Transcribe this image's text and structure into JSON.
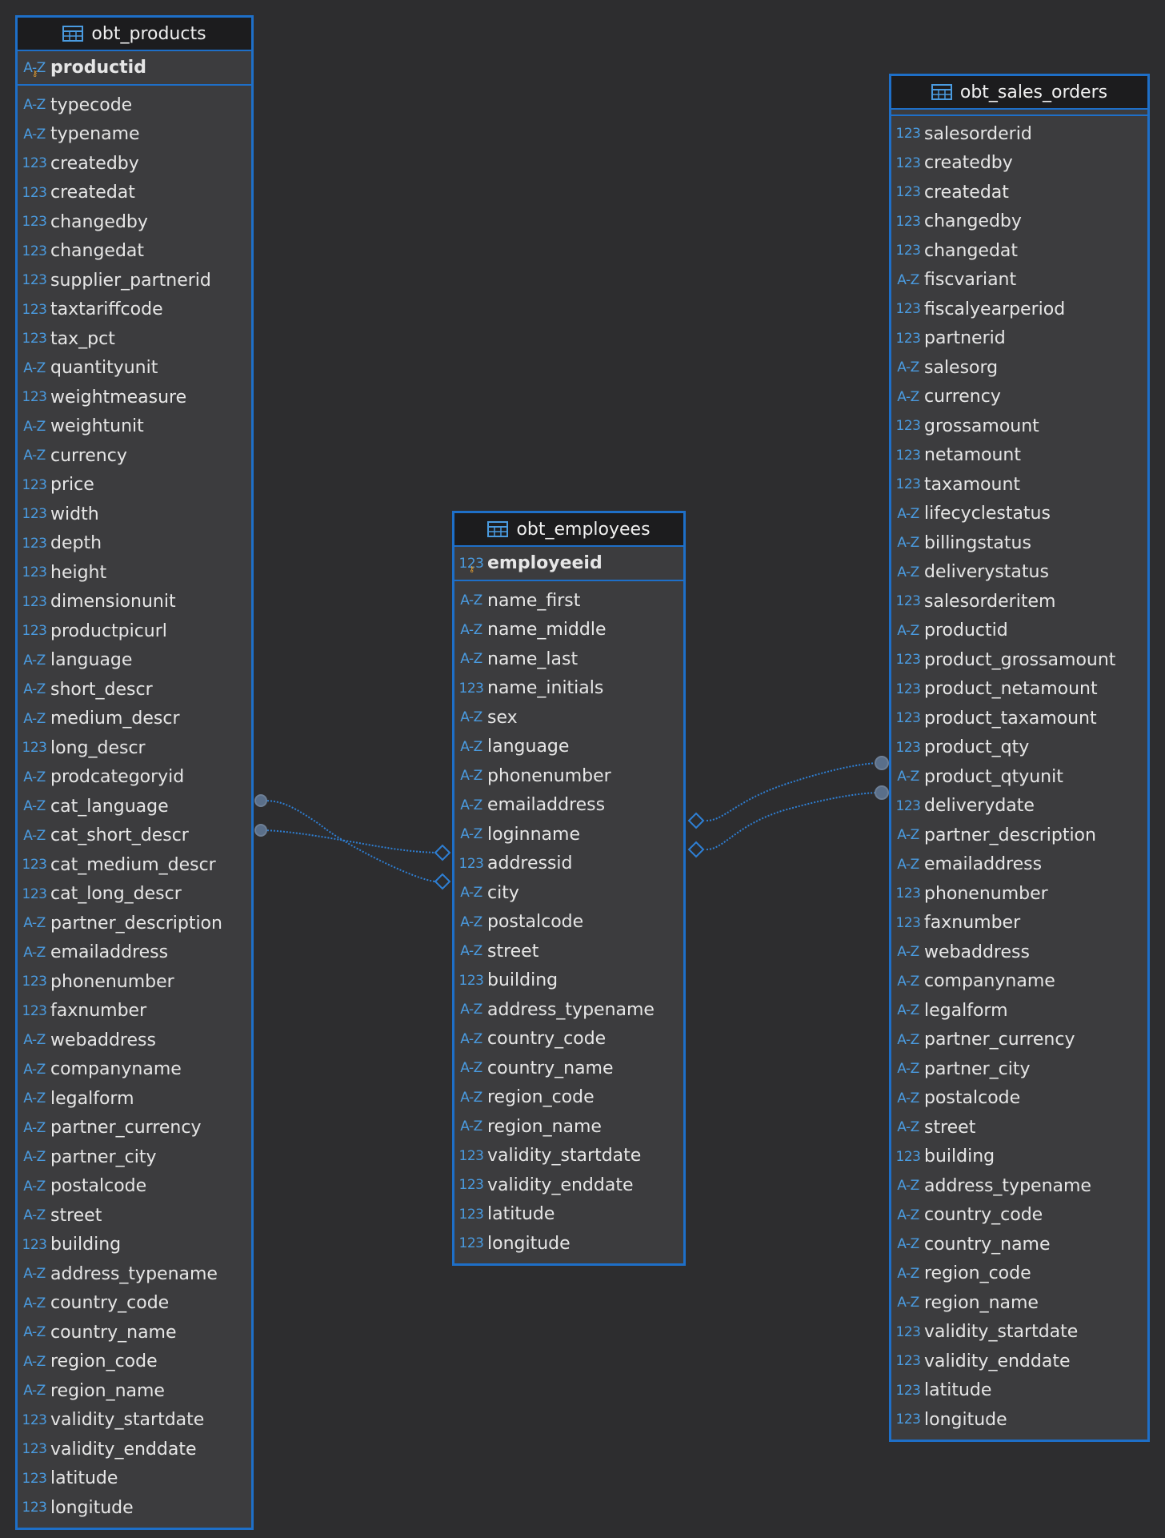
{
  "colors": {
    "background": "#2d2d2f",
    "table": "#3c3c3e",
    "border": "#1e6fc8",
    "type_icon": "#4a9be0",
    "key_icon": "#e8a030",
    "link": "#2e7fd4"
  },
  "icons": {
    "table": "table-icon",
    "text_type": "A-Z",
    "numeric_type": "123"
  },
  "tables": {
    "products": {
      "title": "obt_products",
      "pk": {
        "type": "A-Z",
        "name": "productid"
      },
      "columns": [
        {
          "type": "A-Z",
          "name": "typecode"
        },
        {
          "type": "A-Z",
          "name": "typename"
        },
        {
          "type": "123",
          "name": "createdby"
        },
        {
          "type": "123",
          "name": "createdat"
        },
        {
          "type": "123",
          "name": "changedby"
        },
        {
          "type": "123",
          "name": "changedat"
        },
        {
          "type": "123",
          "name": "supplier_partnerid"
        },
        {
          "type": "123",
          "name": "taxtariffcode"
        },
        {
          "type": "123",
          "name": "tax_pct"
        },
        {
          "type": "A-Z",
          "name": "quantityunit"
        },
        {
          "type": "123",
          "name": "weightmeasure"
        },
        {
          "type": "A-Z",
          "name": "weightunit"
        },
        {
          "type": "A-Z",
          "name": "currency"
        },
        {
          "type": "123",
          "name": "price"
        },
        {
          "type": "123",
          "name": "width"
        },
        {
          "type": "123",
          "name": "depth"
        },
        {
          "type": "123",
          "name": "height"
        },
        {
          "type": "123",
          "name": "dimensionunit"
        },
        {
          "type": "123",
          "name": "productpicurl"
        },
        {
          "type": "A-Z",
          "name": "language"
        },
        {
          "type": "A-Z",
          "name": "short_descr"
        },
        {
          "type": "A-Z",
          "name": "medium_descr"
        },
        {
          "type": "123",
          "name": "long_descr"
        },
        {
          "type": "A-Z",
          "name": "prodcategoryid"
        },
        {
          "type": "A-Z",
          "name": "cat_language"
        },
        {
          "type": "A-Z",
          "name": "cat_short_descr"
        },
        {
          "type": "123",
          "name": "cat_medium_descr"
        },
        {
          "type": "123",
          "name": "cat_long_descr"
        },
        {
          "type": "A-Z",
          "name": "partner_description"
        },
        {
          "type": "A-Z",
          "name": "emailaddress"
        },
        {
          "type": "123",
          "name": "phonenumber"
        },
        {
          "type": "123",
          "name": "faxnumber"
        },
        {
          "type": "A-Z",
          "name": "webaddress"
        },
        {
          "type": "A-Z",
          "name": "companyname"
        },
        {
          "type": "A-Z",
          "name": "legalform"
        },
        {
          "type": "A-Z",
          "name": "partner_currency"
        },
        {
          "type": "A-Z",
          "name": "partner_city"
        },
        {
          "type": "A-Z",
          "name": "postalcode"
        },
        {
          "type": "A-Z",
          "name": "street"
        },
        {
          "type": "123",
          "name": "building"
        },
        {
          "type": "A-Z",
          "name": "address_typename"
        },
        {
          "type": "A-Z",
          "name": "country_code"
        },
        {
          "type": "A-Z",
          "name": "country_name"
        },
        {
          "type": "A-Z",
          "name": "region_code"
        },
        {
          "type": "A-Z",
          "name": "region_name"
        },
        {
          "type": "123",
          "name": "validity_startdate"
        },
        {
          "type": "123",
          "name": "validity_enddate"
        },
        {
          "type": "123",
          "name": "latitude"
        },
        {
          "type": "123",
          "name": "longitude"
        }
      ]
    },
    "employees": {
      "title": "obt_employees",
      "pk": {
        "type": "123",
        "name": "employeeid"
      },
      "columns": [
        {
          "type": "A-Z",
          "name": "name_first"
        },
        {
          "type": "A-Z",
          "name": "name_middle"
        },
        {
          "type": "A-Z",
          "name": "name_last"
        },
        {
          "type": "123",
          "name": "name_initials"
        },
        {
          "type": "A-Z",
          "name": "sex"
        },
        {
          "type": "A-Z",
          "name": "language"
        },
        {
          "type": "A-Z",
          "name": "phonenumber"
        },
        {
          "type": "A-Z",
          "name": "emailaddress"
        },
        {
          "type": "A-Z",
          "name": "loginname"
        },
        {
          "type": "123",
          "name": "addressid"
        },
        {
          "type": "A-Z",
          "name": "city"
        },
        {
          "type": "A-Z",
          "name": "postalcode"
        },
        {
          "type": "A-Z",
          "name": "street"
        },
        {
          "type": "123",
          "name": "building"
        },
        {
          "type": "A-Z",
          "name": "address_typename"
        },
        {
          "type": "A-Z",
          "name": "country_code"
        },
        {
          "type": "A-Z",
          "name": "country_name"
        },
        {
          "type": "A-Z",
          "name": "region_code"
        },
        {
          "type": "A-Z",
          "name": "region_name"
        },
        {
          "type": "123",
          "name": "validity_startdate"
        },
        {
          "type": "123",
          "name": "validity_enddate"
        },
        {
          "type": "123",
          "name": "latitude"
        },
        {
          "type": "123",
          "name": "longitude"
        }
      ]
    },
    "sales_orders": {
      "title": "obt_sales_orders",
      "columns": [
        {
          "type": "123",
          "name": "salesorderid"
        },
        {
          "type": "123",
          "name": "createdby"
        },
        {
          "type": "123",
          "name": "createdat"
        },
        {
          "type": "123",
          "name": "changedby"
        },
        {
          "type": "123",
          "name": "changedat"
        },
        {
          "type": "A-Z",
          "name": "fiscvariant"
        },
        {
          "type": "123",
          "name": "fiscalyearperiod"
        },
        {
          "type": "123",
          "name": "partnerid"
        },
        {
          "type": "A-Z",
          "name": "salesorg"
        },
        {
          "type": "A-Z",
          "name": "currency"
        },
        {
          "type": "123",
          "name": "grossamount"
        },
        {
          "type": "123",
          "name": "netamount"
        },
        {
          "type": "123",
          "name": "taxamount"
        },
        {
          "type": "A-Z",
          "name": "lifecyclestatus"
        },
        {
          "type": "A-Z",
          "name": "billingstatus"
        },
        {
          "type": "A-Z",
          "name": "deliverystatus"
        },
        {
          "type": "123",
          "name": "salesorderitem"
        },
        {
          "type": "A-Z",
          "name": "productid"
        },
        {
          "type": "123",
          "name": "product_grossamount"
        },
        {
          "type": "123",
          "name": "product_netamount"
        },
        {
          "type": "123",
          "name": "product_taxamount"
        },
        {
          "type": "123",
          "name": "product_qty"
        },
        {
          "type": "A-Z",
          "name": "product_qtyunit"
        },
        {
          "type": "123",
          "name": "deliverydate"
        },
        {
          "type": "A-Z",
          "name": "partner_description"
        },
        {
          "type": "A-Z",
          "name": "emailaddress"
        },
        {
          "type": "123",
          "name": "phonenumber"
        },
        {
          "type": "123",
          "name": "faxnumber"
        },
        {
          "type": "A-Z",
          "name": "webaddress"
        },
        {
          "type": "A-Z",
          "name": "companyname"
        },
        {
          "type": "A-Z",
          "name": "legalform"
        },
        {
          "type": "A-Z",
          "name": "partner_currency"
        },
        {
          "type": "A-Z",
          "name": "partner_city"
        },
        {
          "type": "A-Z",
          "name": "postalcode"
        },
        {
          "type": "A-Z",
          "name": "street"
        },
        {
          "type": "123",
          "name": "building"
        },
        {
          "type": "A-Z",
          "name": "address_typename"
        },
        {
          "type": "A-Z",
          "name": "country_code"
        },
        {
          "type": "A-Z",
          "name": "country_name"
        },
        {
          "type": "A-Z",
          "name": "region_code"
        },
        {
          "type": "A-Z",
          "name": "region_name"
        },
        {
          "type": "123",
          "name": "validity_startdate"
        },
        {
          "type": "123",
          "name": "validity_enddate"
        },
        {
          "type": "123",
          "name": "latitude"
        },
        {
          "type": "123",
          "name": "longitude"
        }
      ]
    }
  }
}
